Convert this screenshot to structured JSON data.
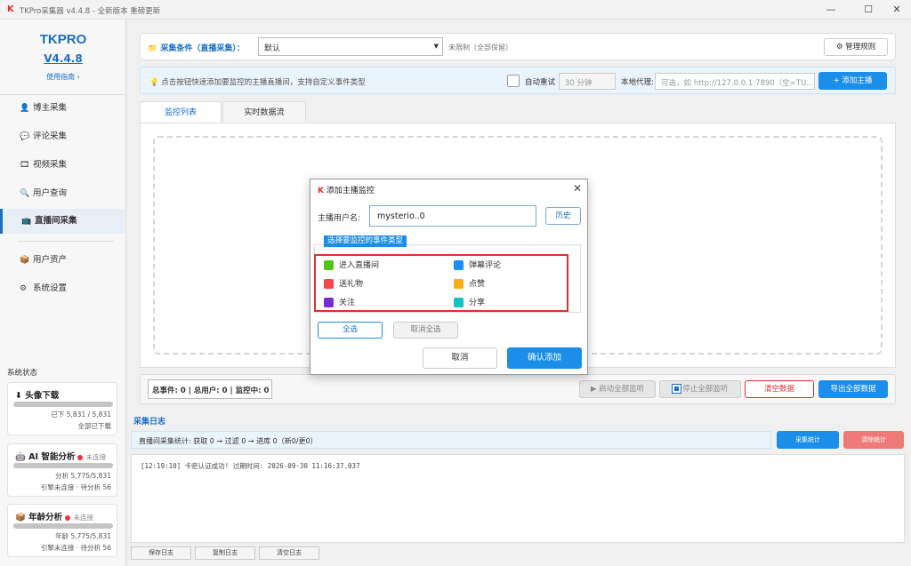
{
  "window": {
    "title": "TKPro采集器 v4.4.8 - 全新版本 重磅更新",
    "controls": {
      "minimize": "—",
      "maximize": "☐",
      "close": "✕"
    }
  },
  "sidebar": {
    "brand": "TKPRO",
    "version": "V4.4.8",
    "guide": "使用指南 ›",
    "items": [
      {
        "label": "博主采集",
        "icon": "user-icon",
        "glyph": "👤"
      },
      {
        "label": "评论采集",
        "icon": "comment-icon",
        "glyph": "💬"
      },
      {
        "label": "视频采集",
        "icon": "video-icon",
        "glyph": "🎞"
      },
      {
        "label": "用户查询",
        "icon": "search-icon",
        "glyph": "🔍"
      },
      {
        "label": "直播间采集",
        "icon": "live-icon",
        "glyph": "📺"
      },
      {
        "label": "用户资产",
        "icon": "asset-icon",
        "glyph": "📦"
      },
      {
        "label": "系统设置",
        "icon": "settings-icon",
        "glyph": "⚙"
      }
    ],
    "system_status_label": "系统状态",
    "cards": [
      {
        "icon": "download-icon",
        "glyph": "⬇",
        "title": "头像下载",
        "status": "",
        "line1": "已下 5,831 / 5,831",
        "line2": "全部已下载"
      },
      {
        "icon": "ai-icon",
        "glyph": "🤖",
        "title": "AI 智能分析",
        "status": "未连接",
        "line1": "分析 5,775/5,831",
        "line2": "引擎未连接 · 待分析 56"
      },
      {
        "icon": "age-icon",
        "glyph": "📦",
        "title": "年龄分析",
        "status": "未连接",
        "line1": "年龄 5,775/5,831",
        "line2": "引擎未连接 · 待分析 56"
      }
    ]
  },
  "toolbar": {
    "condition_label": "采集条件（直播采集）：",
    "condition_value": "默认",
    "limit_text": "未限制（全部保留）",
    "manage_rules": "管理规则",
    "tip": "点击按钮快速添加要监控的主播直播间，支持自定义事件类型",
    "auto_retry": "自动重试",
    "retry_placeholder": "30 分钟",
    "proxy_label": "本地代理:",
    "proxy_placeholder": "可选，如 http://127.0.0.1:7890（空=TU...",
    "add_host": "+ 添加主播"
  },
  "tabs": [
    {
      "label": "监控列表",
      "active": true
    },
    {
      "label": "实时数据流",
      "active": false
    }
  ],
  "stats": {
    "summary": "总事件: 0 | 总用户: 0 | 监控中: 0",
    "start_all": "▶ 启动全部监听",
    "stop_all": "停止全部监听",
    "clear": "清空数据",
    "export": "导出全部数据"
  },
  "log": {
    "title": "采集日志",
    "stats_line": "直播间采集统计: 获取 0 → 过滤 0 → 进库 0（新0/更0）",
    "collect_stats": "采集统计",
    "clear_stats": "清除统计",
    "lines": [
      "[12:19:10] 卡密认证成功! 过期时间: 2026-09-30 11:16:37.037"
    ],
    "buttons": [
      "保存日志",
      "复制日志",
      "清空日志"
    ]
  },
  "dialog": {
    "title": "添加主播监控",
    "username_label": "主播用户名:",
    "username_value": "mysterio..0",
    "history": "历史",
    "events_legend": "选择要监控的事件类型",
    "events": [
      {
        "label": "进入直播间",
        "color": "#52c41a"
      },
      {
        "label": "弹幕评论",
        "color": "#1890ff"
      },
      {
        "label": "送礼物",
        "color": "#f5484d"
      },
      {
        "label": "点赞",
        "color": "#faad14"
      },
      {
        "label": "关注",
        "color": "#722ed1"
      },
      {
        "label": "分享",
        "color": "#13c2c2"
      }
    ],
    "select_all": "全选",
    "deselect_all": "取消全选",
    "cancel": "取消",
    "confirm": "确认添加"
  },
  "colors": {
    "accent": "#1a6ec4",
    "primary_button": "#1a8ee8",
    "danger": "#e03030"
  }
}
